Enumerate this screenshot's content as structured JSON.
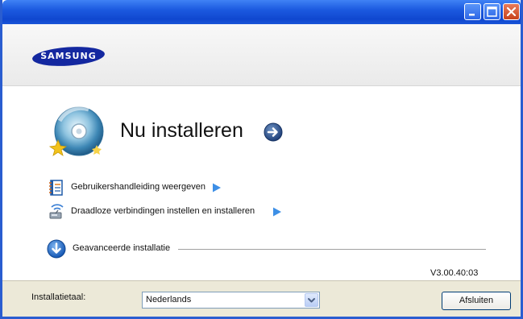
{
  "window": {
    "controls": {
      "minimize_icon": "minimize-icon",
      "maximize_icon": "maximize-icon",
      "close_icon": "close-icon"
    }
  },
  "header": {
    "logo_text": "SAMSUNG",
    "logo_color": "#1428a0"
  },
  "main": {
    "title": "Nu installeren",
    "title_icon": "cd-install-icon",
    "go_icon": "arrow-right-circle-icon",
    "links": [
      {
        "label": "Gebruikershandleiding weergeven",
        "icon": "manual-book-icon",
        "arrow_icon": "play-arrow-icon"
      },
      {
        "label": "Draadloze verbindingen instellen en installeren",
        "icon": "wireless-icon",
        "arrow_icon": "play-arrow-icon"
      }
    ],
    "advanced": {
      "label": "Geavanceerde installatie",
      "icon": "arrow-down-circle-icon"
    },
    "version": "V3.00.40:03"
  },
  "footer": {
    "language_label": "Installatietaal:",
    "language_value": "Nederlands",
    "language_dropdown_icon": "chevron-down-icon",
    "close_label": "Afsluiten"
  },
  "colors": {
    "titlebar": "#1c5ae0",
    "close_button": "#c8421c",
    "accent_blue": "#1e6fd0",
    "footer_bg": "#ece9d8"
  }
}
